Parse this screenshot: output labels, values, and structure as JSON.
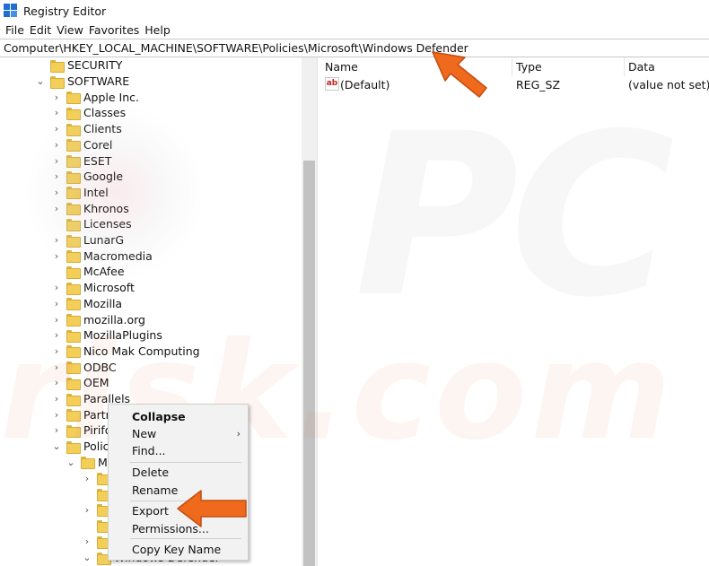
{
  "window": {
    "title": "Registry Editor"
  },
  "menu": [
    "File",
    "Edit",
    "View",
    "Favorites",
    "Help"
  ],
  "address": "Computer\\HKEY_LOCAL_MACHINE\\SOFTWARE\\Policies\\Microsoft\\Windows Defender",
  "tree": [
    {
      "label": "SECURITY",
      "expander": "none"
    },
    {
      "label": "SOFTWARE",
      "expander": "expanded"
    },
    {
      "label": "Apple Inc.",
      "expander": "collapsed"
    },
    {
      "label": "Classes",
      "expander": "collapsed"
    },
    {
      "label": "Clients",
      "expander": "collapsed"
    },
    {
      "label": "Corel",
      "expander": "collapsed"
    },
    {
      "label": "ESET",
      "expander": "collapsed"
    },
    {
      "label": "Google",
      "expander": "collapsed"
    },
    {
      "label": "Intel",
      "expander": "collapsed"
    },
    {
      "label": "Khronos",
      "expander": "collapsed"
    },
    {
      "label": "Licenses",
      "expander": "none"
    },
    {
      "label": "LunarG",
      "expander": "collapsed"
    },
    {
      "label": "Macromedia",
      "expander": "collapsed"
    },
    {
      "label": "McAfee",
      "expander": "none"
    },
    {
      "label": "Microsoft",
      "expander": "collapsed"
    },
    {
      "label": "Mozilla",
      "expander": "collapsed"
    },
    {
      "label": "mozilla.org",
      "expander": "collapsed"
    },
    {
      "label": "MozillaPlugins",
      "expander": "collapsed"
    },
    {
      "label": "Nico Mak Computing",
      "expander": "collapsed"
    },
    {
      "label": "ODBC",
      "expander": "collapsed"
    },
    {
      "label": "OEM",
      "expander": "collapsed"
    },
    {
      "label": "Parallels",
      "expander": "collapsed"
    },
    {
      "label": "Partne",
      "expander": "collapsed"
    },
    {
      "label": "Pirifor",
      "expander": "collapsed"
    },
    {
      "label": "Policie",
      "expander": "expanded"
    },
    {
      "label": "Mi",
      "expander": "expanded"
    },
    {
      "label": "",
      "expander": "collapsed"
    },
    {
      "label": "",
      "expander": "none"
    },
    {
      "label": "",
      "expander": "collapsed"
    },
    {
      "label": "",
      "expander": "none"
    },
    {
      "label": "",
      "expander": "collapsed"
    },
    {
      "label": "Windows Defender",
      "expander": "expanded"
    }
  ],
  "columns": {
    "name": "Name",
    "type": "Type",
    "data": "Data"
  },
  "values": [
    {
      "name": "(Default)",
      "type": "REG_SZ",
      "data": "(value not set)",
      "icon": "ab-string-icon"
    }
  ],
  "context_menu": {
    "collapse": "Collapse",
    "new": "New",
    "find": "Find...",
    "delete": "Delete",
    "rename": "Rename",
    "export": "Export",
    "permissions": "Permissions...",
    "copy_key_name": "Copy Key Name"
  },
  "watermark": {
    "text1": "PC",
    "text2": "risk.com"
  },
  "colors": {
    "folder": "#f3cf5a",
    "callout_arrow": "#f06a1d",
    "app_icon": "#1f6fd0"
  }
}
